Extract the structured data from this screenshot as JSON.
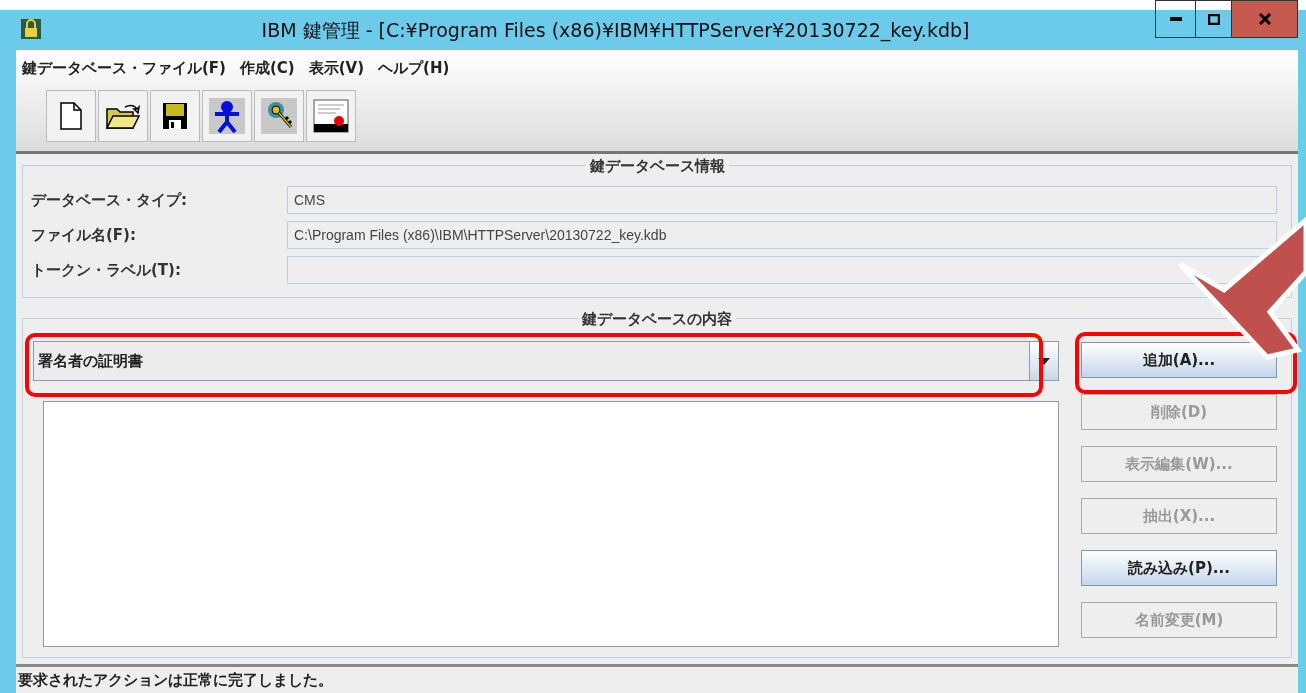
{
  "window": {
    "title": "IBM 鍵管理 - [C:¥Program Files (x86)¥IBM¥HTTPServer¥20130722_key.kdb]"
  },
  "menu": [
    {
      "label": "鍵データベース・ファイル(F)"
    },
    {
      "label": "作成(C)"
    },
    {
      "label": "表示(V)"
    },
    {
      "label": "ヘルプ(H)"
    }
  ],
  "toolbar": [
    {
      "kind": "new"
    },
    {
      "kind": "open"
    },
    {
      "kind": "save"
    },
    {
      "kind": "person"
    },
    {
      "kind": "key"
    },
    {
      "kind": "certificate"
    }
  ],
  "info": {
    "title": "鍵データベース情報",
    "fields": [
      {
        "label": "データベース・タイプ:",
        "value": "CMS"
      },
      {
        "label": "ファイル名(F):",
        "value": "C:\\Program Files (x86)\\IBM\\HTTPServer\\20130722_key.kdb"
      },
      {
        "label": "トークン・ラベル(T):"
      }
    ]
  },
  "contents": {
    "title": "鍵データベースの内容",
    "dropdown": {
      "value": "署名者の証明書",
      "highlighted": true
    },
    "buttons": [
      {
        "label": "追加(A)...",
        "disabled": false,
        "highlighted": true
      },
      {
        "label": "削除(D)",
        "disabled": true,
        "highlighted": false
      },
      {
        "label": "表示編集(W)...",
        "disabled": true,
        "highlighted": false
      },
      {
        "label": "抽出(X)...",
        "disabled": true,
        "highlighted": false
      },
      {
        "label": "読み込み(P)...",
        "disabled": false,
        "highlighted": false
      },
      {
        "label": "名前変更(M)",
        "disabled": true,
        "highlighted": false
      }
    ]
  },
  "annotations": [
    {
      "kind": "arrow"
    }
  ],
  "status_bar": {
    "text": "要求されたアクションは正常に完了しました。"
  }
}
